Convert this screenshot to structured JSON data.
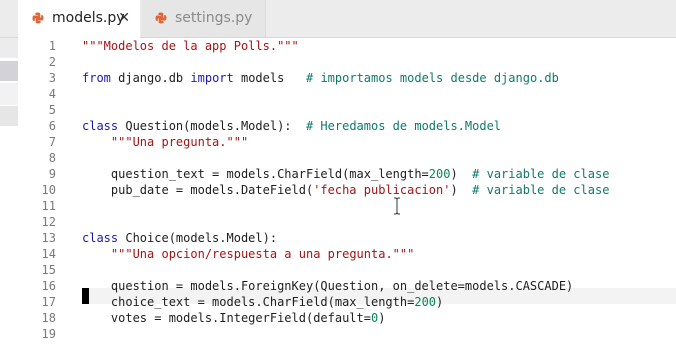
{
  "tabs": [
    {
      "label": "models.py",
      "active": true,
      "close": "✕"
    },
    {
      "label": "settings.py",
      "active": false
    }
  ],
  "colors": {
    "keyword": "#1a1ab0",
    "string": "#a31515",
    "comment": "#0f7a6b",
    "number": "#098658",
    "python_icon": "#e0663a"
  },
  "editor": {
    "line_numbers": [
      "1",
      "2",
      "3",
      "4",
      "5",
      "6",
      "7",
      "8",
      "9",
      "10",
      "11",
      "12",
      "13",
      "14",
      "15",
      "16",
      "17",
      "18",
      "19"
    ],
    "lines": [
      [
        [
          "str",
          "\"\"\"Modelos de la app Polls.\"\"\""
        ]
      ],
      [],
      [
        [
          "kw",
          "from"
        ],
        [
          "t",
          " django.db "
        ],
        [
          "kw",
          "import"
        ],
        [
          "t",
          " models   "
        ],
        [
          "cm",
          "# importamos models desde django.db"
        ]
      ],
      [],
      [],
      [
        [
          "kw",
          "class"
        ],
        [
          "t",
          " Question(models.Model):  "
        ],
        [
          "cm",
          "# Heredamos de models.Model"
        ]
      ],
      [
        [
          "t",
          "    "
        ],
        [
          "str",
          "\"\"\"Una pregunta.\"\"\""
        ]
      ],
      [],
      [
        [
          "t",
          "    question_text = models.CharField(max_length="
        ],
        [
          "num",
          "200"
        ],
        [
          "t",
          ")  "
        ],
        [
          "cm",
          "# variable de clase"
        ]
      ],
      [
        [
          "t",
          "    pub_date = models.DateField("
        ],
        [
          "str",
          "'fecha publicacion'"
        ],
        [
          "t",
          ")  "
        ],
        [
          "cm",
          "# variable de clase"
        ]
      ],
      [],
      [],
      [
        [
          "kw",
          "class"
        ],
        [
          "t",
          " Choice(models.Model):"
        ]
      ],
      [
        [
          "t",
          "    "
        ],
        [
          "str",
          "\"\"\"Una opcion/respuesta a una pregunta.\"\"\""
        ]
      ],
      [],
      [
        [
          "t",
          "    question = models.ForeignKey(Question, on_delete=models.CASCADE)"
        ]
      ],
      [
        [
          "t",
          "    choice_text = models.CharField(max_length="
        ],
        [
          "num",
          "200"
        ],
        [
          "t",
          ")"
        ]
      ],
      [
        [
          "t",
          "    votes = models.IntegerField(default="
        ],
        [
          "num",
          "0"
        ],
        [
          "t",
          ")"
        ]
      ],
      []
    ]
  }
}
